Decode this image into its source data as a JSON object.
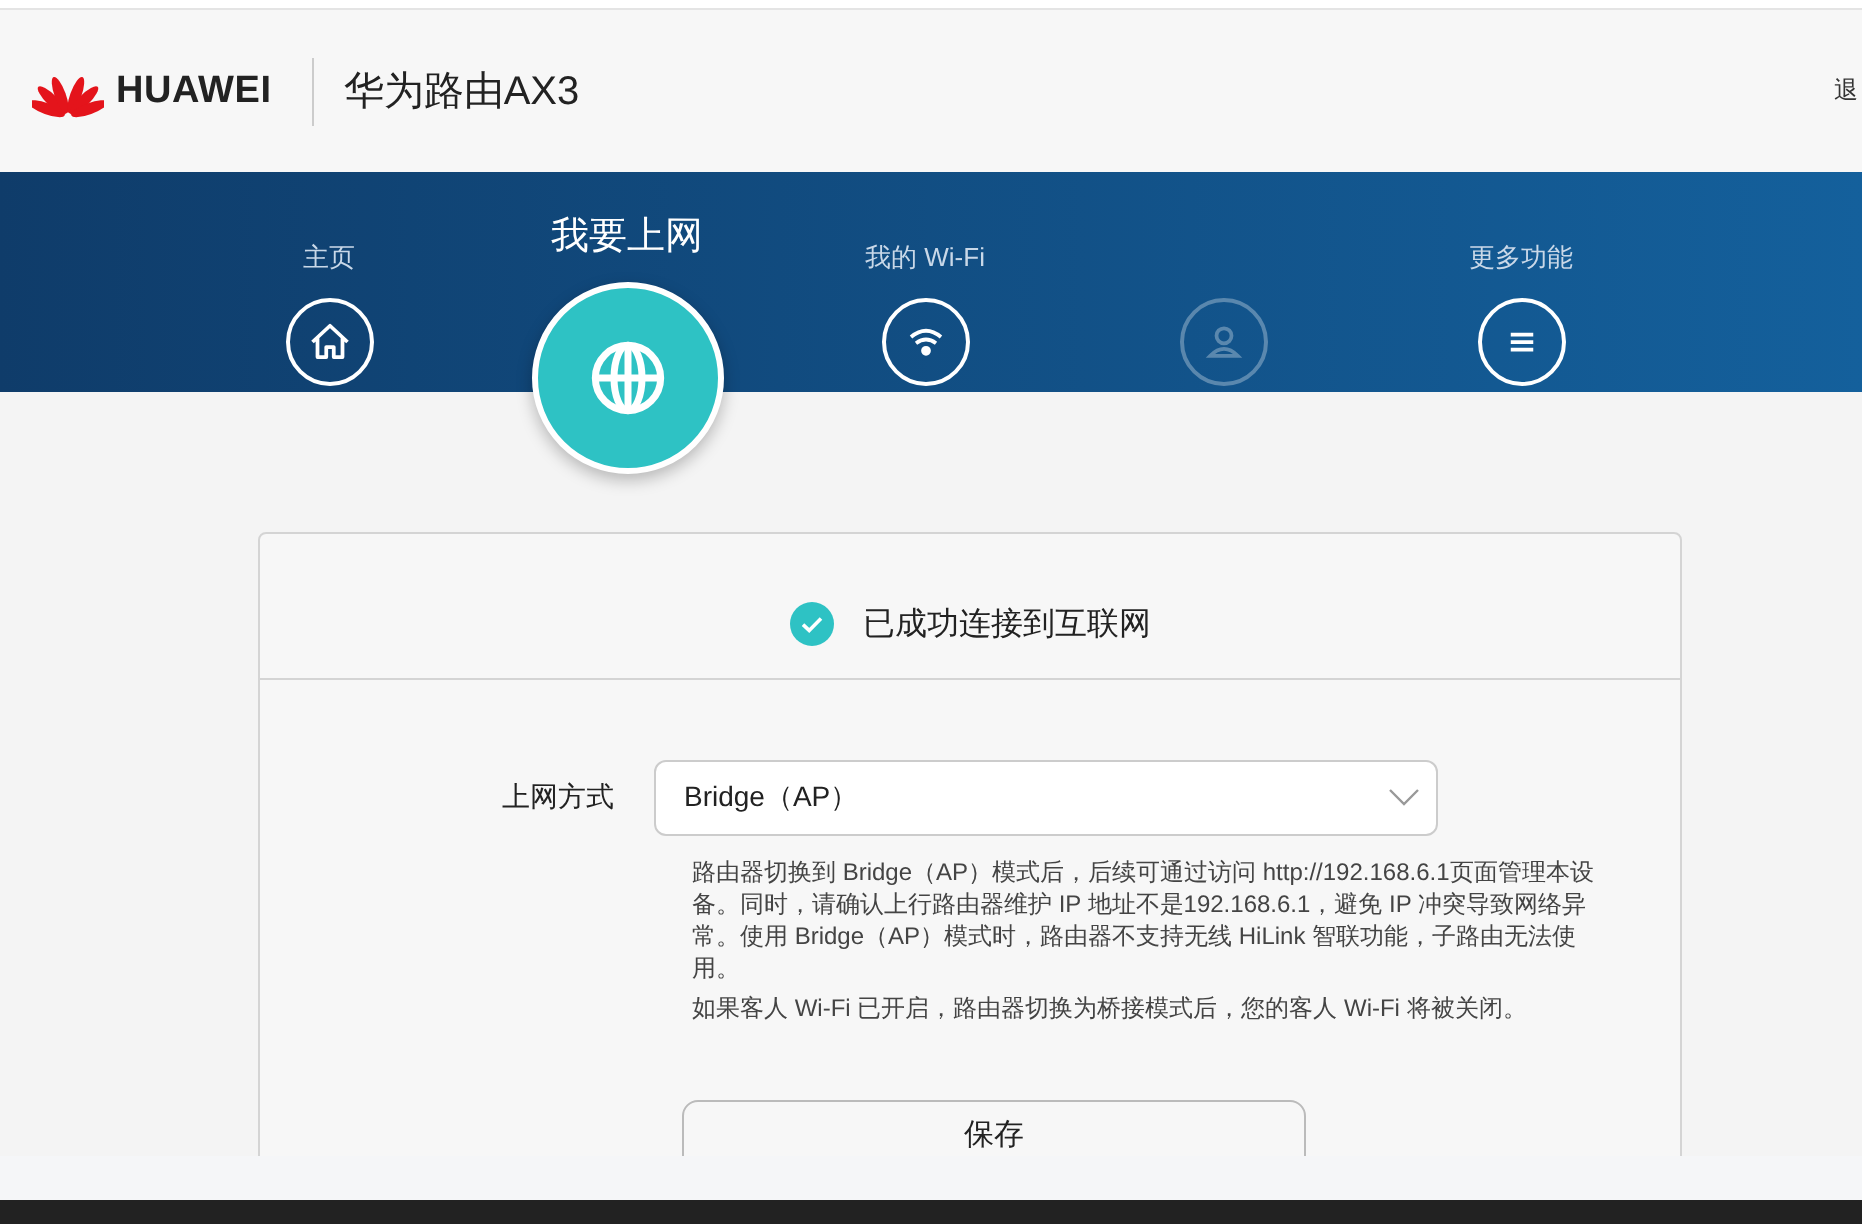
{
  "header": {
    "brand": "HUAWEI",
    "product": "华为路由AX3",
    "logout": "退"
  },
  "nav": [
    {
      "kind": "home",
      "label": "主页",
      "selected": false,
      "disabled": false
    },
    {
      "kind": "internet",
      "label": "我要上网",
      "selected": true,
      "disabled": false
    },
    {
      "kind": "wifi",
      "label": "我的 Wi-Fi",
      "selected": false,
      "disabled": false
    },
    {
      "kind": "account",
      "selected": false,
      "disabled": true
    },
    {
      "kind": "more",
      "label": "更多功能",
      "selected": false,
      "disabled": false
    }
  ],
  "status": {
    "text": "已成功连接到互联网",
    "connected": true
  },
  "form": {
    "label": "上网方式",
    "value": "Bridge（AP）",
    "notes": [
      "路由器切换到 Bridge（AP）模式后，后续可通过访问 http://192.168.6.1页面管理本设备。同时，请确认上行路由器维护 IP 地址不是192.168.6.1，避免 IP 冲突导致网络异常。使用 Bridge（AP）模式时，路由器不支持无线 HiLink 智联功能，子路由无法使用。",
      "如果客人 Wi-Fi 已开启，路由器切换为桥接模式后，您的客人 Wi-Fi 将被关闭。"
    ],
    "save": "保存"
  }
}
